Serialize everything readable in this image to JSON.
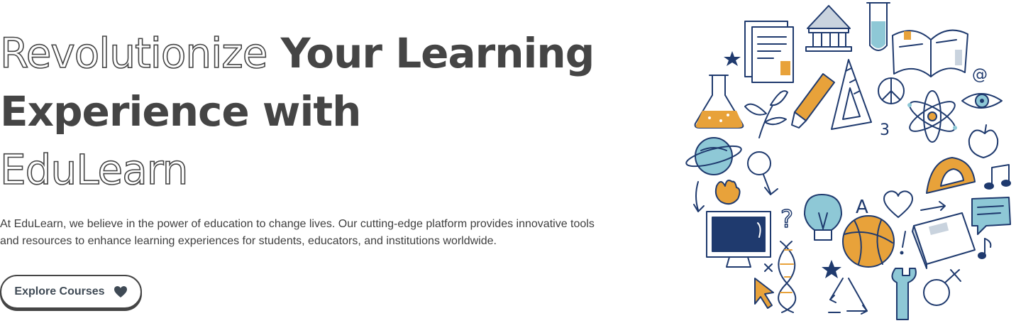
{
  "hero": {
    "headline_outline_1": "Revolutionize",
    "headline_solid": "Your Learning Experience with",
    "headline_outline_2": "EduLearn",
    "description": "At EduLearn, we believe in the power of education to change lives. Our cutting-edge platform provides innovative tools and resources to enhance learning experiences for students, educators, and institutions worldwide.",
    "cta_label": "Explore Courses",
    "cta_icon": "heart-icon"
  },
  "illustration": {
    "icons": [
      "document-icon",
      "museum-icon",
      "test-tube-icon",
      "open-book-icon",
      "star-icon",
      "flask-icon",
      "plant-icon",
      "pencil-icon",
      "ruler-triangle-icon",
      "peace-icon",
      "atom-icon",
      "at-sign-icon",
      "eye-icon",
      "apple-icon",
      "planet-icon",
      "magnifier-icon",
      "hand-icon",
      "protractor-icon",
      "music-note-icon",
      "question-icon",
      "lightbulb-icon",
      "letter-a-icon",
      "heart-outline-icon",
      "book-icon",
      "chat-bubble-icon",
      "monitor-icon",
      "dna-icon",
      "basketball-icon",
      "cursor-icon",
      "recycle-icon",
      "wrench-icon",
      "gender-icon"
    ],
    "text_glyphs": {
      "three": "3",
      "letter_a": "A",
      "question": "?",
      "at": "@"
    },
    "colors": {
      "navy": "#1f3a6e",
      "orange": "#e8a23a",
      "light_blue": "#8ec8d6",
      "gray_blue": "#c9d3de"
    }
  }
}
